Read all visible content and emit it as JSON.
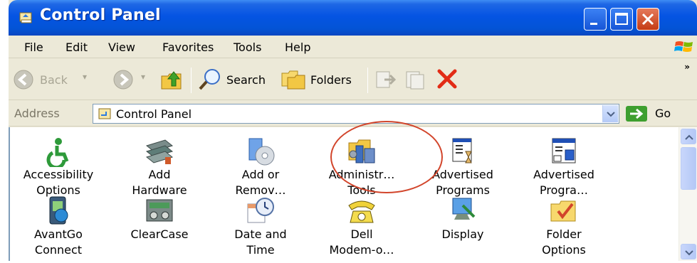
{
  "window": {
    "title": "Control Panel",
    "colors": {
      "titlebar": "#0554E3",
      "close": "#C43B14",
      "highlight_circle": "#D2452B"
    }
  },
  "menubar": {
    "items": [
      "File",
      "Edit",
      "View",
      "Favorites",
      "Tools",
      "Help"
    ]
  },
  "toolbar": {
    "back_label": "Back",
    "search_label": "Search",
    "folders_label": "Folders",
    "overflow": "»"
  },
  "address": {
    "label": "Address",
    "value": "Control Panel",
    "go_label": "Go"
  },
  "items": [
    {
      "label": "Accessibility\nOptions",
      "icon": "accessibility-icon"
    },
    {
      "label": "Add\nHardware",
      "icon": "add-hardware-icon"
    },
    {
      "label": "Add or\nRemov…",
      "icon": "add-remove-programs-icon"
    },
    {
      "label": "Administr…\nTools",
      "icon": "administrative-tools-icon"
    },
    {
      "label": "Advertised\nPrograms",
      "icon": "advertised-programs-icon"
    },
    {
      "label": "Advertised\nProgra…",
      "icon": "advertised-programs-icon"
    },
    {
      "label": "AvantGo\nConnect",
      "icon": "avantgo-icon"
    },
    {
      "label": "ClearCase",
      "icon": "clearcase-icon"
    },
    {
      "label": "Date and\nTime",
      "icon": "date-time-icon"
    },
    {
      "label": "Dell\nModem-o…",
      "icon": "phone-icon"
    },
    {
      "label": "Display",
      "icon": "display-icon"
    },
    {
      "label": "Folder\nOptions",
      "icon": "folder-options-icon"
    }
  ]
}
